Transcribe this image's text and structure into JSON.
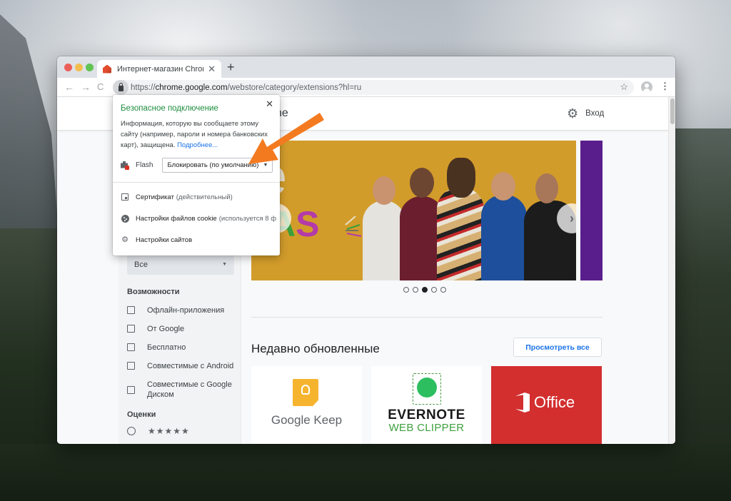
{
  "browser": {
    "tab": {
      "title": "Интернет-магазин Chrome - I",
      "close": "✕"
    },
    "new_tab": "+",
    "nav": {
      "back": "←",
      "forward": "→",
      "reload": "C"
    },
    "url": {
      "scheme": "https://",
      "host": "chrome.google.com",
      "path": "/webstore/category/extensions?hl=ru"
    },
    "star": "☆",
    "menu": "⋮"
  },
  "store": {
    "title_partial": "ne",
    "login": "Вход"
  },
  "site_info_popup": {
    "title": "Безопасное подключение",
    "description": "Информация, которую вы сообщаете этому сайту (например, пароли и номера банковских карт), защищена.",
    "link": "Подробнее...",
    "close": "✕",
    "flash": {
      "label": "Flash",
      "selected": "Блокировать (по умолчанию)"
    },
    "items": [
      {
        "icon": "certificate-icon",
        "label": "Сертификат",
        "detail": "(действительный)"
      },
      {
        "icon": "cookie-icon",
        "label": "Настройки файлов cookie",
        "detail": "(используется 8 ф"
      },
      {
        "icon": "gear-icon",
        "label": "Настройки сайтов",
        "detail": ""
      }
    ]
  },
  "sidebar": {
    "filter_select": "Все",
    "features_heading": "Возможности",
    "features": [
      {
        "label": "Офлайн-приложения",
        "checked": false
      },
      {
        "label": "От Google",
        "checked": false
      },
      {
        "label": "Бесплатно",
        "checked": false
      },
      {
        "label": "Совместимые с Android",
        "checked": false
      },
      {
        "label": "Совместимые с Google Диском",
        "checked": false
      }
    ],
    "ratings_heading": "Оценки",
    "rating_option": {
      "stars": "★★★★★",
      "selected": false
    }
  },
  "carousel": {
    "prev": "‹",
    "next": "›",
    "banner_text": {
      "top": "oe",
      "a": "A",
      "s": "S"
    },
    "slide_count": 5,
    "active_slide": 3
  },
  "recently_updated": {
    "title": "Недавно обновленные",
    "view_all": "Просмотреть все",
    "cards": [
      {
        "name": "Google Keep"
      },
      {
        "name": "EVERNOTE",
        "subtitle": "WEB CLIPPER"
      },
      {
        "name": "Office"
      }
    ]
  },
  "colors": {
    "secure_green": "#1e8e3e",
    "link_blue": "#1a73e8",
    "annotation_orange": "#f47a20",
    "banner_gold": "#d29c2b",
    "office_red": "#d32f2f"
  }
}
